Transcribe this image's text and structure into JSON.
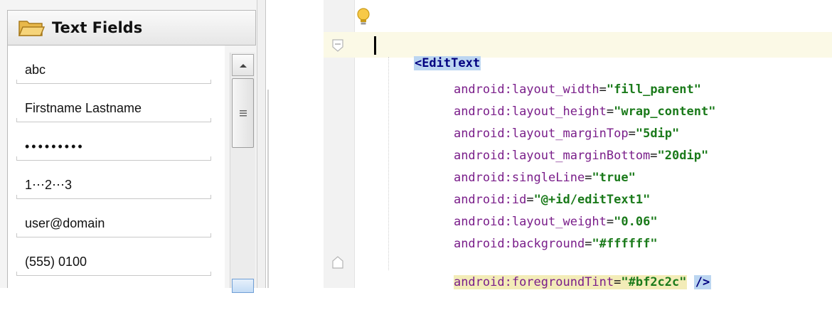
{
  "palette": {
    "title": "Text Fields",
    "fields": [
      {
        "value": "abc"
      },
      {
        "value": "Firstname Lastname"
      },
      {
        "value": "•••••••••"
      },
      {
        "value": "1⋯2⋯3"
      },
      {
        "value": "user@domain"
      },
      {
        "value": "(555) 0100"
      }
    ]
  },
  "editor": {
    "tag_open": "<EditText",
    "attributes": [
      {
        "name": "android:layout_width",
        "value": "\"fill_parent\""
      },
      {
        "name": "android:layout_height",
        "value": "\"wrap_content\""
      },
      {
        "name": "android:layout_marginTop",
        "value": "\"5dip\""
      },
      {
        "name": "android:layout_marginBottom",
        "value": "\"20dip\""
      },
      {
        "name": "android:singleLine",
        "value": "\"true\""
      },
      {
        "name": "android:id",
        "value": "\"@+id/editText1\""
      },
      {
        "name": "android:layout_weight",
        "value": "\"0.06\""
      },
      {
        "name": "android:background",
        "value": "\"#ffffff\""
      },
      {
        "name": "android:foregroundTint",
        "value": "\"#bf2c2c\""
      }
    ],
    "tag_close": "/>"
  },
  "colors": {
    "attribute": "#7a1e8a",
    "value": "#1a7a1a",
    "tag": "#000080",
    "current_line": "#fbf9e6",
    "attr_highlight": "#f3ecb8",
    "tag_highlight": "#bcd6f1"
  },
  "icons": [
    "folder-icon",
    "lightbulb-icon",
    "fold-icon",
    "scroll-up-arrow-icon",
    "scroll-grip-icon"
  ]
}
